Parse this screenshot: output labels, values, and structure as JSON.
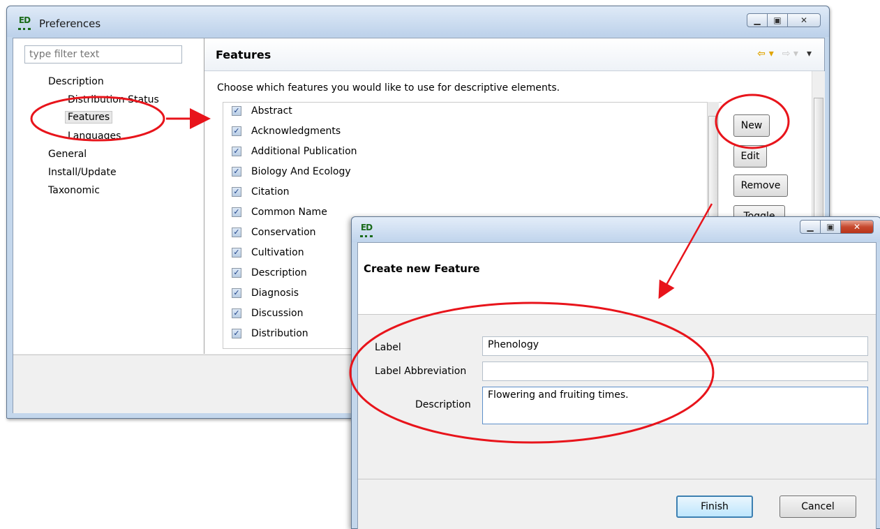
{
  "preferences_window": {
    "title": "Preferences",
    "filter_placeholder": "type filter text",
    "tree": [
      {
        "label": "Description"
      },
      {
        "label": "Distribution Status"
      },
      {
        "label": "Features"
      },
      {
        "label": "Languages"
      },
      {
        "label": "General"
      },
      {
        "label": "Install/Update"
      },
      {
        "label": "Taxonomic"
      }
    ],
    "page_title": "Features",
    "page_description": "Choose which features you would like to use for descriptive elements.",
    "features": [
      {
        "label": "Abstract",
        "checked": true
      },
      {
        "label": "Acknowledgments",
        "checked": true
      },
      {
        "label": "Additional Publication",
        "checked": true
      },
      {
        "label": "Biology And Ecology",
        "checked": true
      },
      {
        "label": "Citation",
        "checked": true
      },
      {
        "label": "Common Name",
        "checked": true
      },
      {
        "label": "Conservation",
        "checked": true
      },
      {
        "label": "Cultivation",
        "checked": true
      },
      {
        "label": "Description",
        "checked": true
      },
      {
        "label": "Diagnosis",
        "checked": true
      },
      {
        "label": "Discussion",
        "checked": true
      },
      {
        "label": "Distribution",
        "checked": true
      }
    ],
    "buttons": {
      "new": "New",
      "edit": "Edit",
      "remove": "Remove",
      "toggle": "Toggle"
    },
    "check_glyph": "✓",
    "app_icon_text": "ED"
  },
  "dialog": {
    "heading": "Create new Feature",
    "app_icon_text": "ED",
    "label_label": "Label",
    "label_value": "Phenology",
    "abbrev_label": "Label Abbreviation",
    "abbrev_value": "",
    "description_label": "Description",
    "description_value": "Flowering and fruiting times.",
    "finish_label": "Finish",
    "cancel_label": "Cancel"
  },
  "annotation_color": "#e8141b"
}
